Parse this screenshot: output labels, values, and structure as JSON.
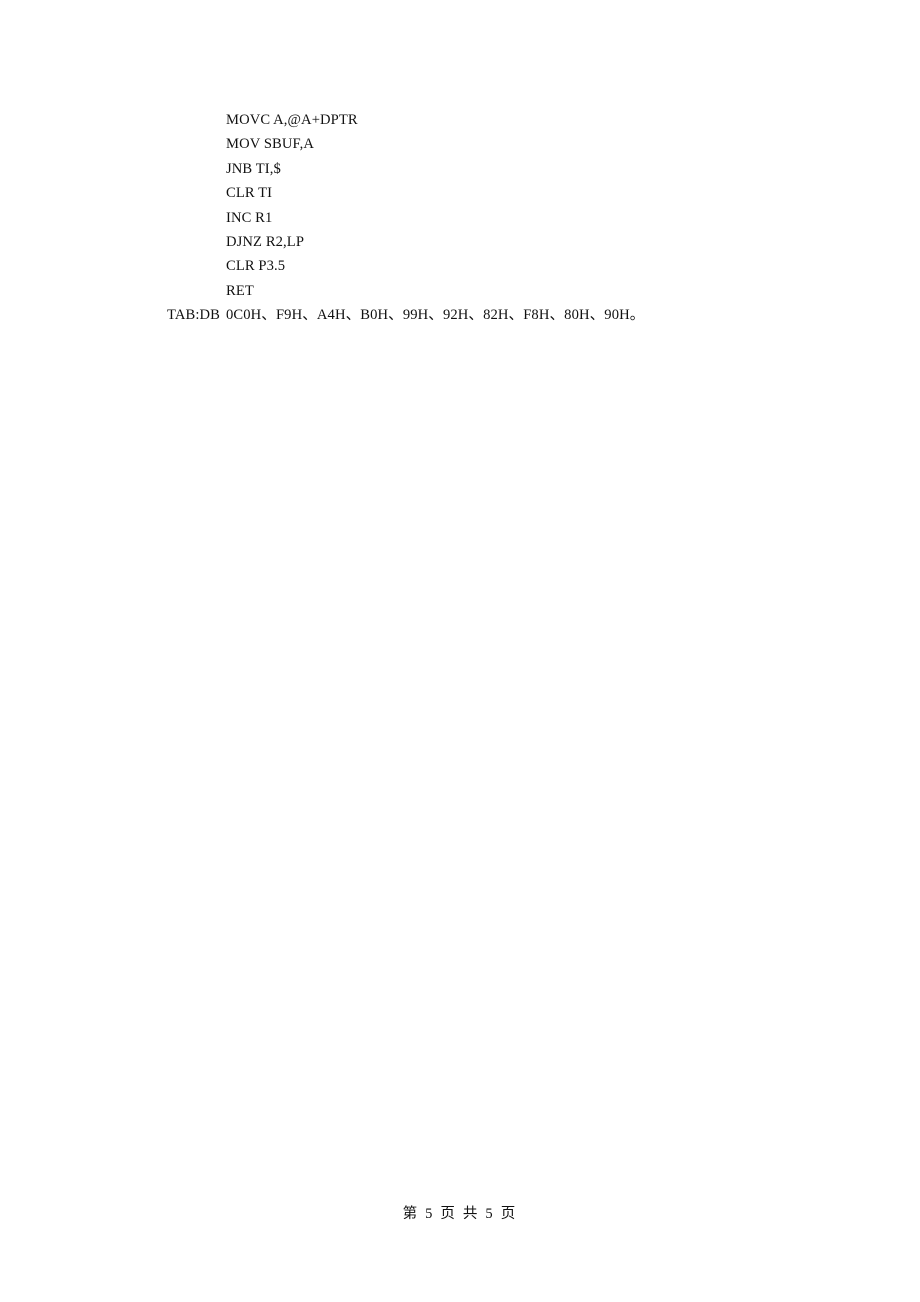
{
  "document": {
    "page_background": "#ffffff",
    "text_color": "#111111",
    "code_block": {
      "lines": [
        {
          "label": "",
          "text": "MOVC A,@A+DPTR"
        },
        {
          "label": "",
          "text": "MOV SBUF,A"
        },
        {
          "label": "",
          "text": "JNB TI,$"
        },
        {
          "label": "",
          "text": "CLR TI"
        },
        {
          "label": "",
          "text": "INC R1"
        },
        {
          "label": "",
          "text": "DJNZ R2,LP"
        },
        {
          "label": "",
          "text": "CLR P3.5"
        },
        {
          "label": "",
          "text": "RET"
        },
        {
          "label": "TAB:DB",
          "text": "0C0H、F9H、A4H、B0H、99H、92H、82H、F8H、80H、90H。"
        }
      ]
    },
    "footer": {
      "text": "第 5 页 共 5 页",
      "page_number": "5",
      "total_pages": "5"
    }
  }
}
